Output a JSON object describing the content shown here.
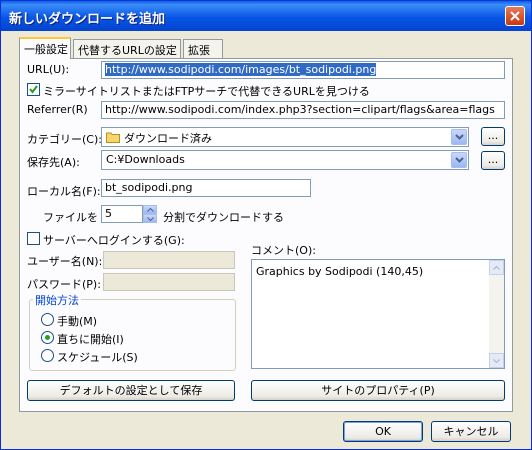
{
  "window": {
    "title": "新しいダウンロードを追加"
  },
  "tabs": [
    {
      "label": "一般設定"
    },
    {
      "label": "代替するURLの設定"
    },
    {
      "label": "拡張"
    }
  ],
  "url": {
    "label": "URL(U):",
    "value": "http://www.sodipodi.com/images/bt_sodipodi.png"
  },
  "mirror": {
    "label": "ミラーサイトリストまたはFTPサーチで代替できるURLを見つける",
    "checked": true
  },
  "referrer": {
    "label": "Referrer(R)",
    "value": "http://www.sodipodi.com/index.php3?section=clipart/flags&area=flags"
  },
  "category": {
    "label": "カテゴリー(C):",
    "value": "ダウンロード済み",
    "browse": "..."
  },
  "saveto": {
    "label": "保存先(A):",
    "value": "C:¥Downloads",
    "browse": "..."
  },
  "localname": {
    "label": "ローカル名(F):",
    "value": "bt_sodipodi.png"
  },
  "split": {
    "prefix": "ファイルを",
    "value": "5",
    "suffix": "分割でダウンロードする"
  },
  "login": {
    "label": "サーバーへログインする(G):",
    "checked": false
  },
  "username": {
    "label": "ユーザー名(N):",
    "value": ""
  },
  "password": {
    "label": "パスワード(P):",
    "value": ""
  },
  "start": {
    "title": "開始方法",
    "options": [
      {
        "label": "手動(M)",
        "selected": false
      },
      {
        "label": "直ちに開始(I)",
        "selected": true
      },
      {
        "label": "スケジュール(S)",
        "selected": false
      }
    ]
  },
  "comment": {
    "label": "コメント(O):",
    "value": "Graphics by Sodipodi (140,45)"
  },
  "buttons": {
    "save_default": "デフォルトの設定として保存",
    "site_props": "サイトのプロパティ(P)",
    "ok": "OK",
    "cancel": "キャンセル"
  }
}
